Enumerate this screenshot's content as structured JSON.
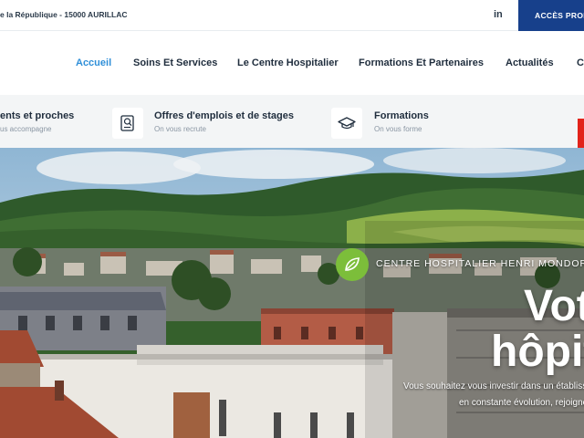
{
  "topbar": {
    "address": "e la République - 15000 AURILLAC",
    "linkedin": "in",
    "pro_button": "ACCÈS PROFESSIONNELS"
  },
  "nav": {
    "items": [
      {
        "label": "Accueil",
        "active": true
      },
      {
        "label": "Soins Et Services"
      },
      {
        "label": "Le Centre Hospitalier"
      },
      {
        "label": "Formations Et Partenaires"
      },
      {
        "label": "Actualités"
      },
      {
        "label": "Contact"
      }
    ]
  },
  "subnav": {
    "items": [
      {
        "title": "ents et proches",
        "subtitle": "us accompagne"
      },
      {
        "title": "Offres d'emplois et de stages",
        "subtitle": "On vous recrute",
        "icon": "job-offer-icon"
      },
      {
        "title": "Formations",
        "subtitle": "On vous forme",
        "icon": "graduation-cap-icon"
      }
    ]
  },
  "hero": {
    "label": "CENTRE HOSPITALIER HENRI MONDOR D'AURILLAC",
    "headline_line1": "Votre",
    "headline_line2": "hôpital",
    "text_line1": "Vous souhaitez vous investir dans un établissement",
    "text_line2": "en constante évolution, rejoignez-nous !"
  },
  "colors": {
    "brand_blue": "#17408b",
    "accent_blue": "#2f8fd8",
    "accent_green": "#7cbe3a",
    "accent_red": "#e2231a"
  }
}
